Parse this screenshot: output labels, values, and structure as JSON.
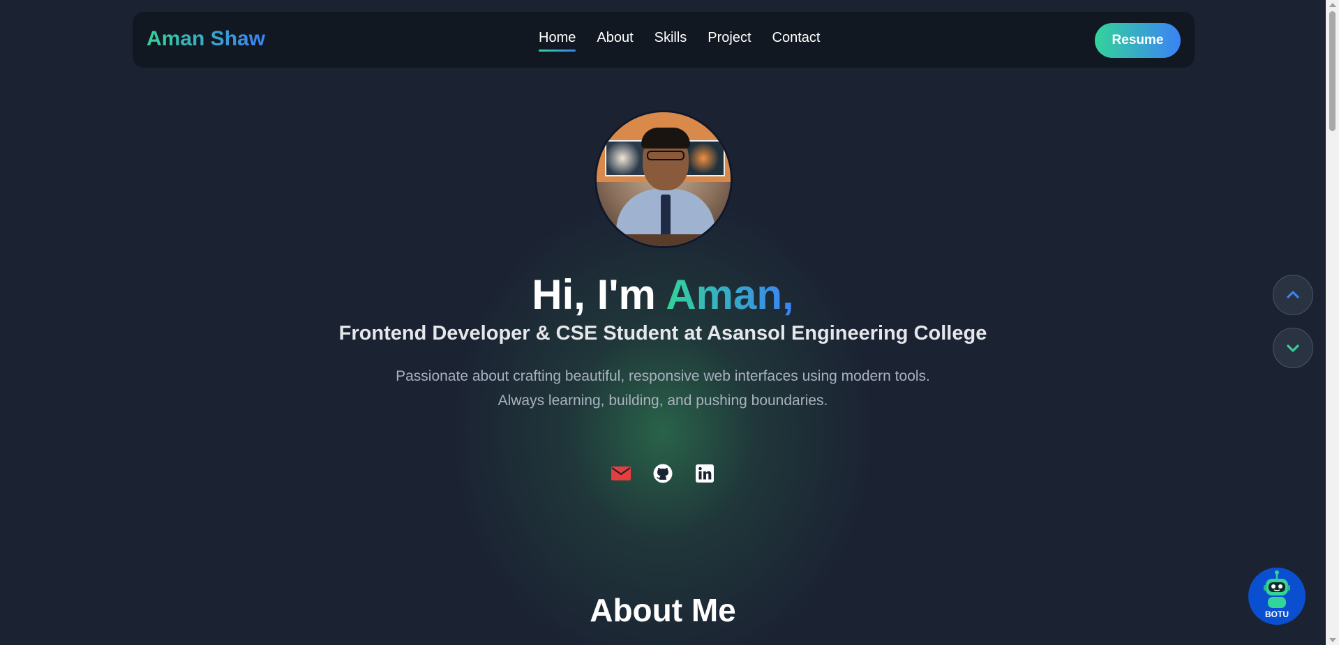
{
  "nav": {
    "brand": "Aman Shaw",
    "links": [
      {
        "label": "Home",
        "active": true
      },
      {
        "label": "About",
        "active": false
      },
      {
        "label": "Skills",
        "active": false
      },
      {
        "label": "Project",
        "active": false
      },
      {
        "label": "Contact",
        "active": false
      }
    ],
    "resume_label": "Resume"
  },
  "hero": {
    "greeting": "Hi, I'm ",
    "name": "Aman,",
    "subtitle": "Frontend Developer & CSE Student at Asansol Engineering College",
    "description_line1": "Passionate about crafting beautiful, responsive web interfaces using modern tools.",
    "description_line2": "Always learning, building, and pushing boundaries.",
    "socials": [
      {
        "icon": "email-icon"
      },
      {
        "icon": "github-icon"
      },
      {
        "icon": "linkedin-icon"
      }
    ]
  },
  "about": {
    "heading": "About Me"
  },
  "widgets": {
    "scroll_up_icon": "chevron-up-icon",
    "scroll_down_icon": "chevron-down-icon",
    "bot_label": "BOTU"
  },
  "colors": {
    "background": "#1b2333",
    "navbar": "#121821",
    "gradient_start": "#34d399",
    "gradient_end": "#3b82f6",
    "email": "#e53e3e",
    "bot": "#0b4fd1"
  }
}
